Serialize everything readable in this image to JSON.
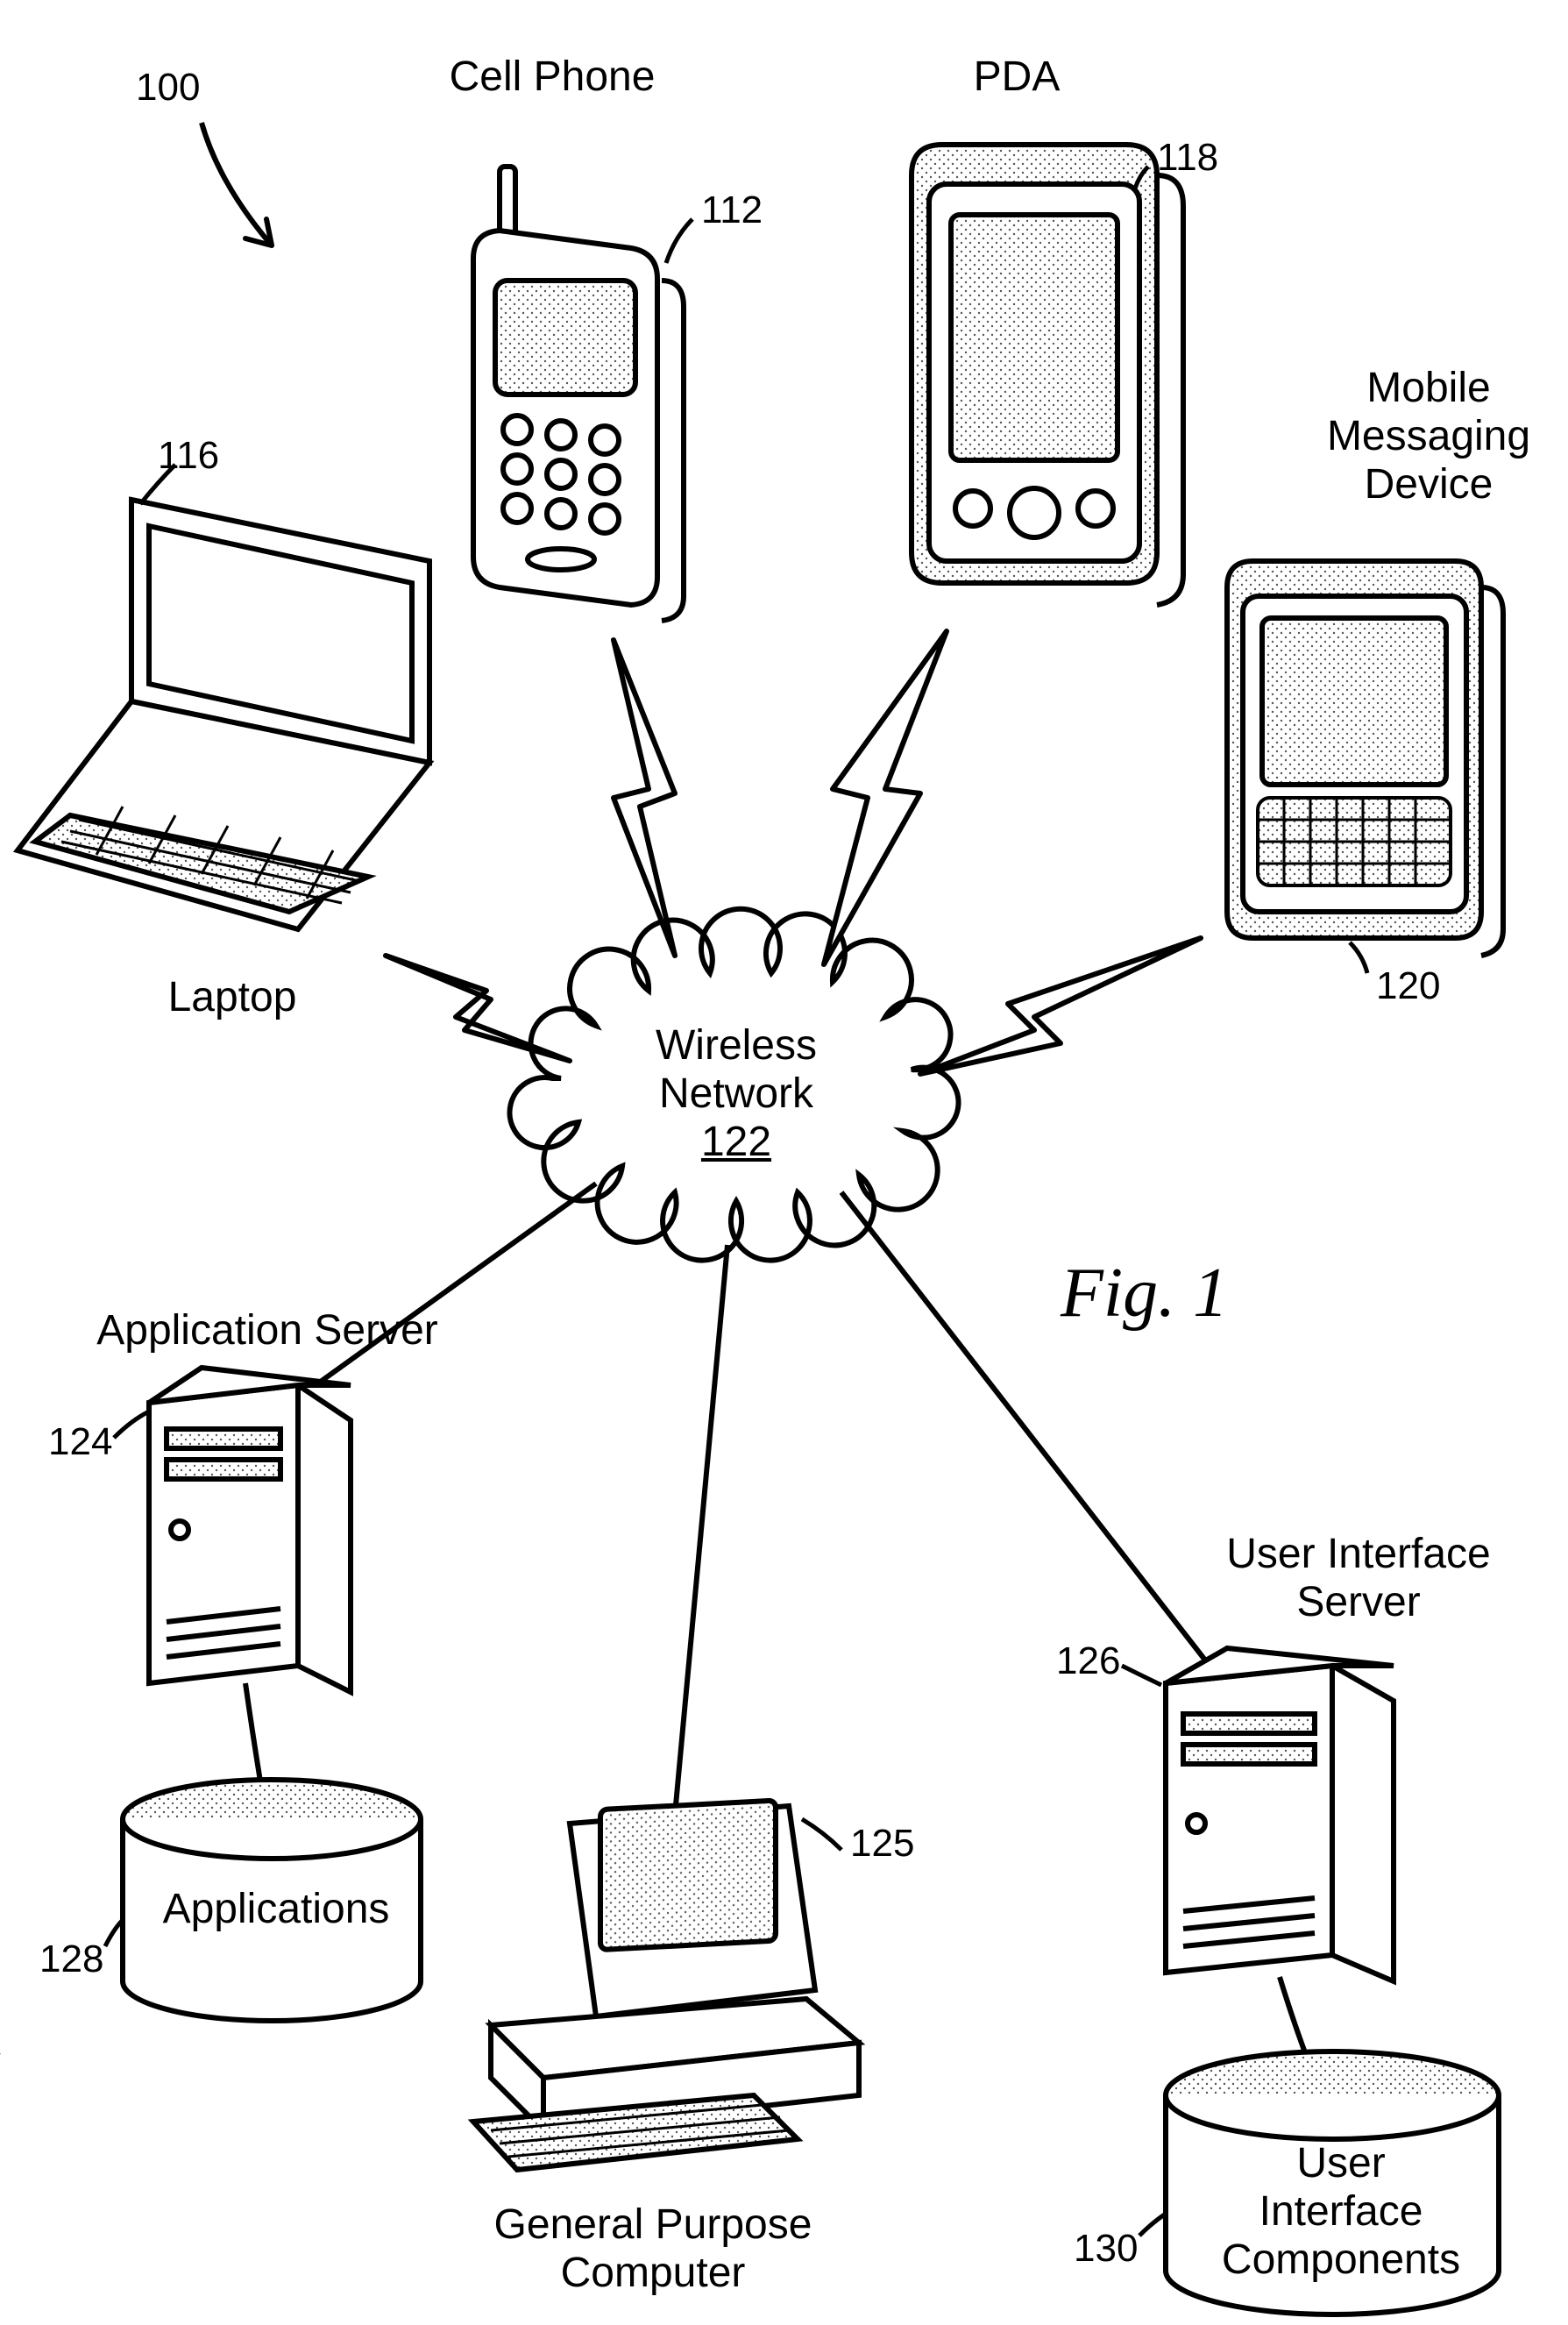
{
  "figure_label": "Fig. 1",
  "figure_ref": "100",
  "center": {
    "label_line1": "Wireless",
    "label_line2": "Network",
    "ref": "122"
  },
  "nodes": {
    "laptop": {
      "label": "Laptop",
      "ref": "116"
    },
    "cellphone": {
      "label": "Cell Phone",
      "ref": "112"
    },
    "pda": {
      "label": "PDA",
      "ref": "118"
    },
    "mmd": {
      "label": "Mobile\nMessaging\nDevice",
      "ref": "120"
    },
    "appserver": {
      "label": "Application Server",
      "ref": "124"
    },
    "appdb": {
      "label": "Applications",
      "ref": "128"
    },
    "gpc": {
      "label": "General Purpose\nComputer",
      "ref": "125"
    },
    "uiserver": {
      "label": "User Interface\nServer",
      "ref": "126"
    },
    "uidb": {
      "label": "User\nInterface\nComponents",
      "ref": "130"
    }
  }
}
